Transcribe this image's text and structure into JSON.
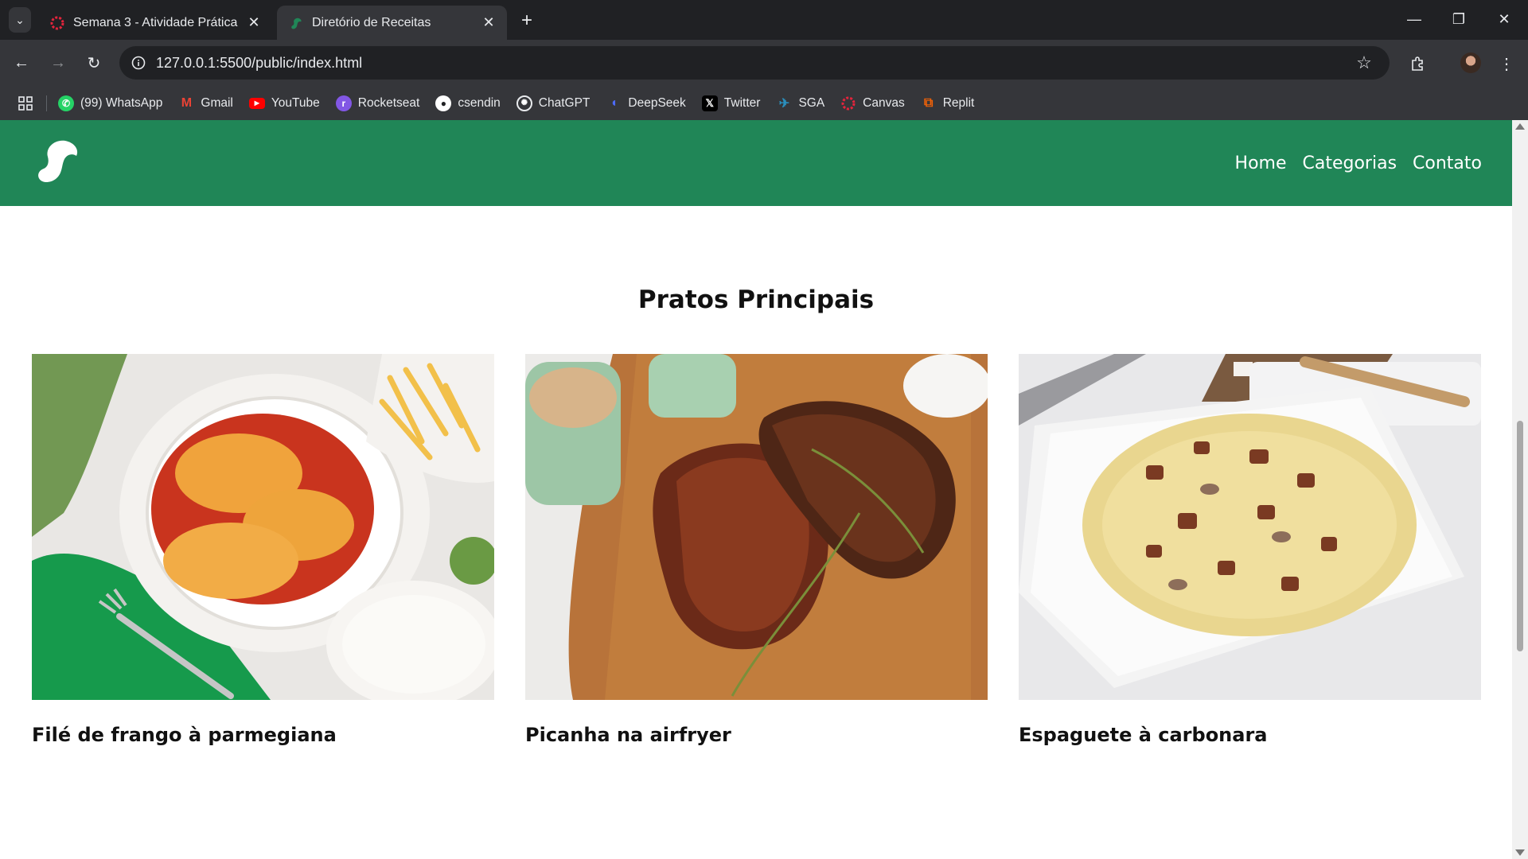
{
  "browser": {
    "tabs": [
      {
        "title": "Semana 3 - Atividade Prática",
        "favicon": "canvas-icon",
        "active": false
      },
      {
        "title": "Diretório de Receitas",
        "favicon": "site-logo-icon",
        "active": true
      }
    ],
    "url": "127.0.0.1:5500/public/index.html",
    "bookmarks": [
      {
        "label": "(99) WhatsApp",
        "icon": "whatsapp-icon",
        "color": "#25d366"
      },
      {
        "label": "Gmail",
        "icon": "gmail-icon",
        "color": "#ea4335"
      },
      {
        "label": "YouTube",
        "icon": "youtube-icon",
        "color": "#ff0000"
      },
      {
        "label": "Rocketseat",
        "icon": "rocketseat-icon",
        "color": "#8257e5"
      },
      {
        "label": "csendin",
        "icon": "github-icon",
        "color": "#ffffff"
      },
      {
        "label": "ChatGPT",
        "icon": "chatgpt-icon",
        "color": "#ffffff"
      },
      {
        "label": "DeepSeek",
        "icon": "deepseek-icon",
        "color": "#4d6bfe"
      },
      {
        "label": "Twitter",
        "icon": "x-icon",
        "color": "#000000"
      },
      {
        "label": "SGA",
        "icon": "sga-icon",
        "color": "#2a8fbd"
      },
      {
        "label": "Canvas",
        "icon": "canvas-icon",
        "color": "#e4243c"
      },
      {
        "label": "Replit",
        "icon": "replit-icon",
        "color": "#f26207"
      }
    ]
  },
  "site": {
    "brand_color": "#208657",
    "nav": [
      "Home",
      "Categorias",
      "Contato"
    ],
    "section_title": "Pratos Principais",
    "recipes": [
      {
        "name": "Filé de frango à parmegiana",
        "image": "chicken-parmigiana-photo"
      },
      {
        "name": "Picanha na airfryer",
        "image": "picanha-steak-photo"
      },
      {
        "name": "Espaguete à carbonara",
        "image": "spaghetti-carbonara-photo"
      }
    ]
  }
}
